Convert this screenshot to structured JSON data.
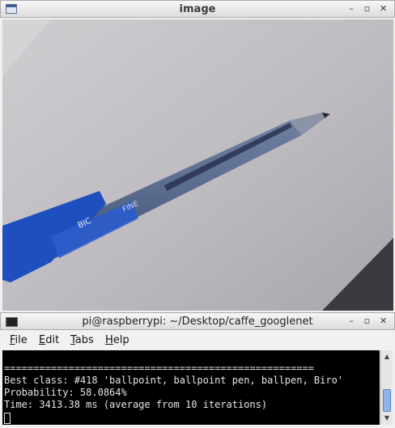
{
  "image_window": {
    "title": "image",
    "controls": {
      "minimize": "–",
      "maximize": "▫",
      "close": "✕"
    }
  },
  "terminal_window": {
    "title": "pi@raspberrypi: ~/Desktop/caffe_googlenet",
    "controls": {
      "minimize": "–",
      "maximize": "▫",
      "close": "✕"
    },
    "menu": [
      "File",
      "Edit",
      "Tabs",
      "Help"
    ],
    "lines": [
      "=====================================================",
      "Best class: #418 'ballpoint, ballpoint pen, ballpen, Biro'",
      "Probability: 58.0864%",
      "Time: 3413.38 ms (average from 10 iterations)"
    ]
  },
  "colors": {
    "terminal_bg": "#000000",
    "terminal_fg": "#e6e6e6",
    "scroll_thumb": "#8fb3e6"
  }
}
